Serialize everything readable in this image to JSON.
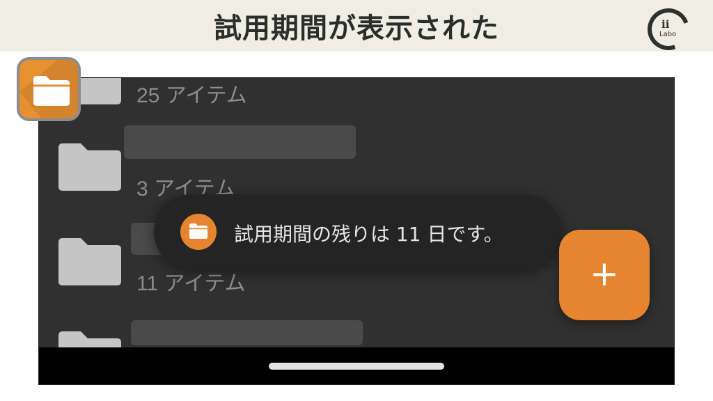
{
  "banner": {
    "title": "試用期間が表示された",
    "logo_top": "ii",
    "logo_bottom": "Labo"
  },
  "app": {
    "icon": "folder-icon",
    "accent_color": "#e68430"
  },
  "list": {
    "items": [
      {
        "icon": "folder-icon",
        "count": "25 アイテム"
      },
      {
        "icon": "folder-icon",
        "count": "3 アイテム"
      },
      {
        "icon": "folder-icon",
        "count": "11 アイテム"
      },
      {
        "icon": "folder-icon",
        "count": ""
      }
    ]
  },
  "toast": {
    "icon": "folder-icon",
    "message": "試用期間の残りは 11 日です。"
  },
  "fab": {
    "label": "+",
    "icon": "plus-icon"
  }
}
